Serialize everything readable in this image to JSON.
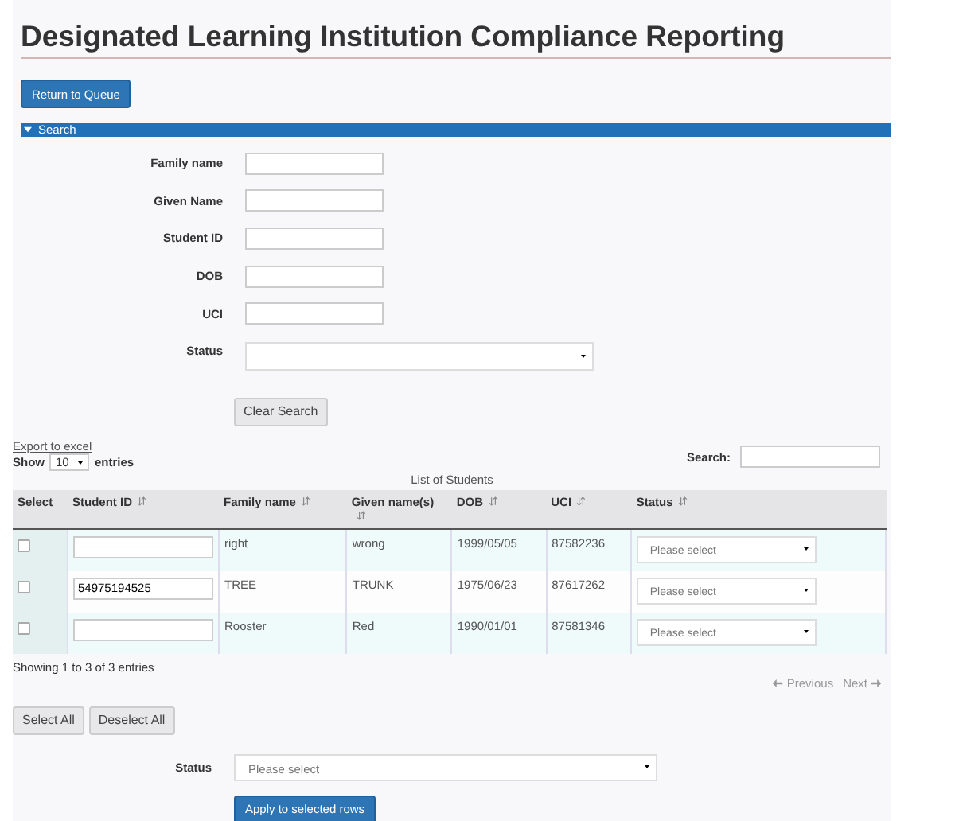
{
  "title": "Designated Learning Institution Compliance Reporting",
  "return_button": "Return to Queue",
  "search_section": {
    "label": "Search",
    "expanded": true
  },
  "search_fields": [
    {
      "label": "Family name",
      "kind": "text"
    },
    {
      "label": "Given Name",
      "kind": "text"
    },
    {
      "label": "Student ID",
      "kind": "text"
    },
    {
      "label": "DOB",
      "kind": "text"
    },
    {
      "label": "UCI",
      "kind": "text"
    },
    {
      "label": "Status",
      "kind": "select"
    }
  ],
  "clear_button": "Clear Search",
  "export_link": "Export to excel",
  "length": {
    "prefix": "Show",
    "value": "10",
    "suffix": "entries"
  },
  "filter": {
    "label": "Search:"
  },
  "table": {
    "caption": "List of Students",
    "columns": [
      {
        "label": "Select",
        "sortable": false
      },
      {
        "label": "Student ID",
        "sortable": true
      },
      {
        "label": "Family name",
        "sortable": true
      },
      {
        "label": "Given name(s)",
        "sortable": true
      },
      {
        "label": "DOB",
        "sortable": true
      },
      {
        "label": "UCI",
        "sortable": true
      },
      {
        "label": "Status",
        "sortable": true
      }
    ],
    "rows": [
      {
        "checked": false,
        "student_id": "",
        "family_name": "right",
        "given_names": "wrong",
        "dob": "1999/05/05",
        "uci": "87582236",
        "status": "Please select"
      },
      {
        "checked": false,
        "student_id": "54975194525",
        "family_name": "TREE",
        "given_names": "TRUNK",
        "dob": "1975/06/23",
        "uci": "87617262",
        "status": "Please select"
      },
      {
        "checked": false,
        "student_id": "",
        "family_name": "Rooster",
        "given_names": "Red",
        "dob": "1990/01/01",
        "uci": "87581346",
        "status": "Please select"
      }
    ]
  },
  "info": "Showing 1 to 3 of 3 entries",
  "pagination": {
    "previous": "Previous",
    "next": "Next",
    "previous_disabled": true,
    "next_disabled": true
  },
  "select_all_button": "Select All",
  "deselect_all_button": "Deselect All",
  "bulk_status": {
    "label": "Status",
    "placeholder": "Please select"
  },
  "apply_button": "Apply to selected rows"
}
